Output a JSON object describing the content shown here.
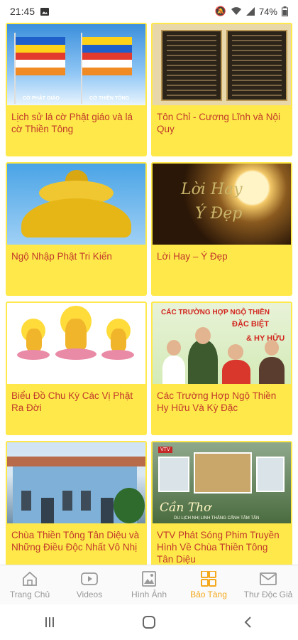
{
  "status_bar": {
    "time": "21:45",
    "battery": "74%"
  },
  "cards": [
    {
      "title": "Lịch sử lá cờ Phật giáo và lá cờ Thiền Tông",
      "image_labels": [
        "CỜ PHẬT GIÁO",
        "CỜ THIỀN TÔNG"
      ]
    },
    {
      "title": "Tôn Chỉ - Cương Lĩnh và Nội Quy"
    },
    {
      "title": "Ngộ Nhập Phật Tri Kiến"
    },
    {
      "title": "Lời Hay – Ý Đẹp",
      "image_text": [
        "Lời Hay",
        "Ý Đẹp"
      ]
    },
    {
      "title": "Biểu Đồ Chu Kỳ Các Vị Phật Ra Đời"
    },
    {
      "title": "Các Trường Hợp Ngộ Thiền Hy Hữu Và Kỳ Đặc",
      "image_text": [
        "CÁC TRƯỜNG HỢP NGỘ THIỀN",
        "ĐẶC BIỆT",
        "& HY HỮU"
      ]
    },
    {
      "title": "Chùa Thiền Tông Tân Diệu và Những Điều Độc Nhất Vô Nhị"
    },
    {
      "title": "VTV Phát Sóng Phim Truyền Hình Về Chùa Thiền Tông Tân Diệu",
      "image_text": [
        "VTV",
        "Cần Thơ",
        "DU LỊCH NHỊ LINH THẮNG CẢNH TÂM TÂN"
      ]
    }
  ],
  "bottom_nav": [
    {
      "label": "Trang Chủ",
      "icon": "home-icon",
      "active": false
    },
    {
      "label": "Videos",
      "icon": "play-icon",
      "active": false
    },
    {
      "label": "Hình Ảnh",
      "icon": "image-icon",
      "active": false
    },
    {
      "label": "Bảo Tàng",
      "icon": "grid-icon",
      "active": true
    },
    {
      "label": "Thư Độc Giả",
      "icon": "mail-icon",
      "active": false
    }
  ],
  "colors": {
    "card_bg": "#ffe94a",
    "title_text": "#c0392b",
    "active_tab": "#f4a91c",
    "inactive_tab": "#999999"
  }
}
